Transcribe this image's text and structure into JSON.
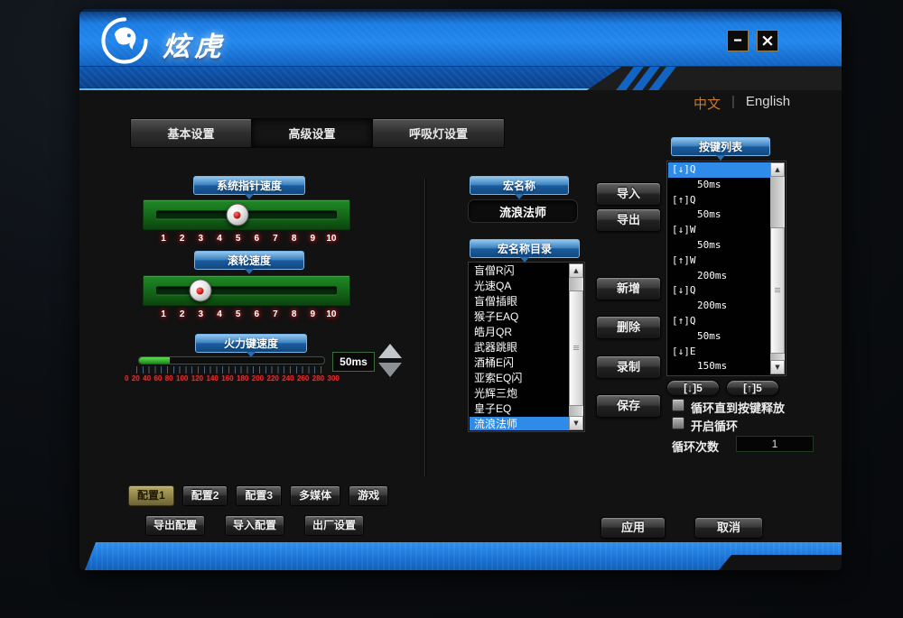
{
  "header": {
    "brand": "炫虎",
    "lang_zh": "中文",
    "lang_divider": "|",
    "lang_en": "English"
  },
  "icons": {
    "minimize": "━",
    "close": "×",
    "scroll_up": "▲",
    "scroll_down": "▼"
  },
  "tabs": [
    {
      "label": "基本设置",
      "active": false
    },
    {
      "label": "高级设置",
      "active": true
    },
    {
      "label": "呼吸灯设置",
      "active": false
    }
  ],
  "sliders": {
    "pointer": {
      "label": "系统指针速度",
      "value": 5,
      "min": 1,
      "max": 10,
      "ticks": [
        "1",
        "2",
        "3",
        "4",
        "5",
        "6",
        "7",
        "8",
        "9",
        "10"
      ]
    },
    "wheel": {
      "label": "滚轮速度",
      "value": 3,
      "min": 1,
      "max": 10,
      "ticks": [
        "1",
        "2",
        "3",
        "4",
        "5",
        "6",
        "7",
        "8",
        "9",
        "10"
      ]
    },
    "fire": {
      "label": "火力键速度",
      "value": 50,
      "max": 300,
      "value_text": "50ms",
      "ticks": [
        "0",
        "20",
        "40",
        "60",
        "80",
        "100",
        "120",
        "140",
        "160",
        "180",
        "200",
        "220",
        "240",
        "260",
        "280",
        "300"
      ]
    }
  },
  "macro": {
    "name_label": "宏名称",
    "name_value": "流浪法师",
    "import_label": "导入",
    "export_label": "导出",
    "dir_label": "宏名称目录",
    "items": [
      {
        "label": "盲僧R闪"
      },
      {
        "label": "光速QA"
      },
      {
        "label": "盲僧插眼"
      },
      {
        "label": "猴子EAQ"
      },
      {
        "label": "皓月QR"
      },
      {
        "label": "武器跳眼"
      },
      {
        "label": "酒桶E闪"
      },
      {
        "label": "亚索EQ闪"
      },
      {
        "label": "光辉三炮"
      },
      {
        "label": "皇子EQ"
      },
      {
        "label": "流浪法师",
        "selected": true
      }
    ],
    "add_label": "新增",
    "delete_label": "删除",
    "record_label": "录制",
    "save_label": "保存"
  },
  "keys": {
    "label": "按键列表",
    "entries": [
      {
        "text": "[↓]Q",
        "selected": true
      },
      {
        "text": "50ms",
        "indent": true
      },
      {
        "text": "[↑]Q"
      },
      {
        "text": "50ms",
        "indent": true
      },
      {
        "text": "[↓]W"
      },
      {
        "text": "50ms",
        "indent": true
      },
      {
        "text": "[↑]W"
      },
      {
        "text": "200ms",
        "indent": true
      },
      {
        "text": "[↓]Q"
      },
      {
        "text": "200ms",
        "indent": true
      },
      {
        "text": "[↑]Q"
      },
      {
        "text": "50ms",
        "indent": true
      },
      {
        "text": "[↓]E"
      },
      {
        "text": "150ms",
        "indent": true
      }
    ],
    "delay_down_label": "[↓]5",
    "delay_up_label": "[↑]5",
    "loop_until_label": "循环直到按键释放",
    "loop_enable_label": "开启循环",
    "loop_count_label": "循环次数",
    "loop_count_value": "1"
  },
  "profiles": [
    {
      "label": "配置1",
      "active": true
    },
    {
      "label": "配置2",
      "active": false
    },
    {
      "label": "配置3",
      "active": false
    },
    {
      "label": "多媒体",
      "active": false
    },
    {
      "label": "游戏",
      "active": false
    }
  ],
  "config_actions": [
    {
      "label": "导出配置"
    },
    {
      "label": "导入配置"
    },
    {
      "label": "出厂设置"
    }
  ],
  "footer": {
    "apply_label": "应用",
    "cancel_label": "取消"
  },
  "colors": {
    "header_blue": "#1b7ce2",
    "band_blue": "#0d56b0",
    "label_blue_top": "#93c7ee",
    "selected_blue": "#2f8be8",
    "green_board": "#1f8a25",
    "tick_glow_red": "#ff1e1e",
    "fire_number_red": "#df2e2e",
    "lang_active_orange": "#c57a30",
    "profile_active_gold": "#8d8146",
    "footer_blue": "#1b74d6"
  }
}
